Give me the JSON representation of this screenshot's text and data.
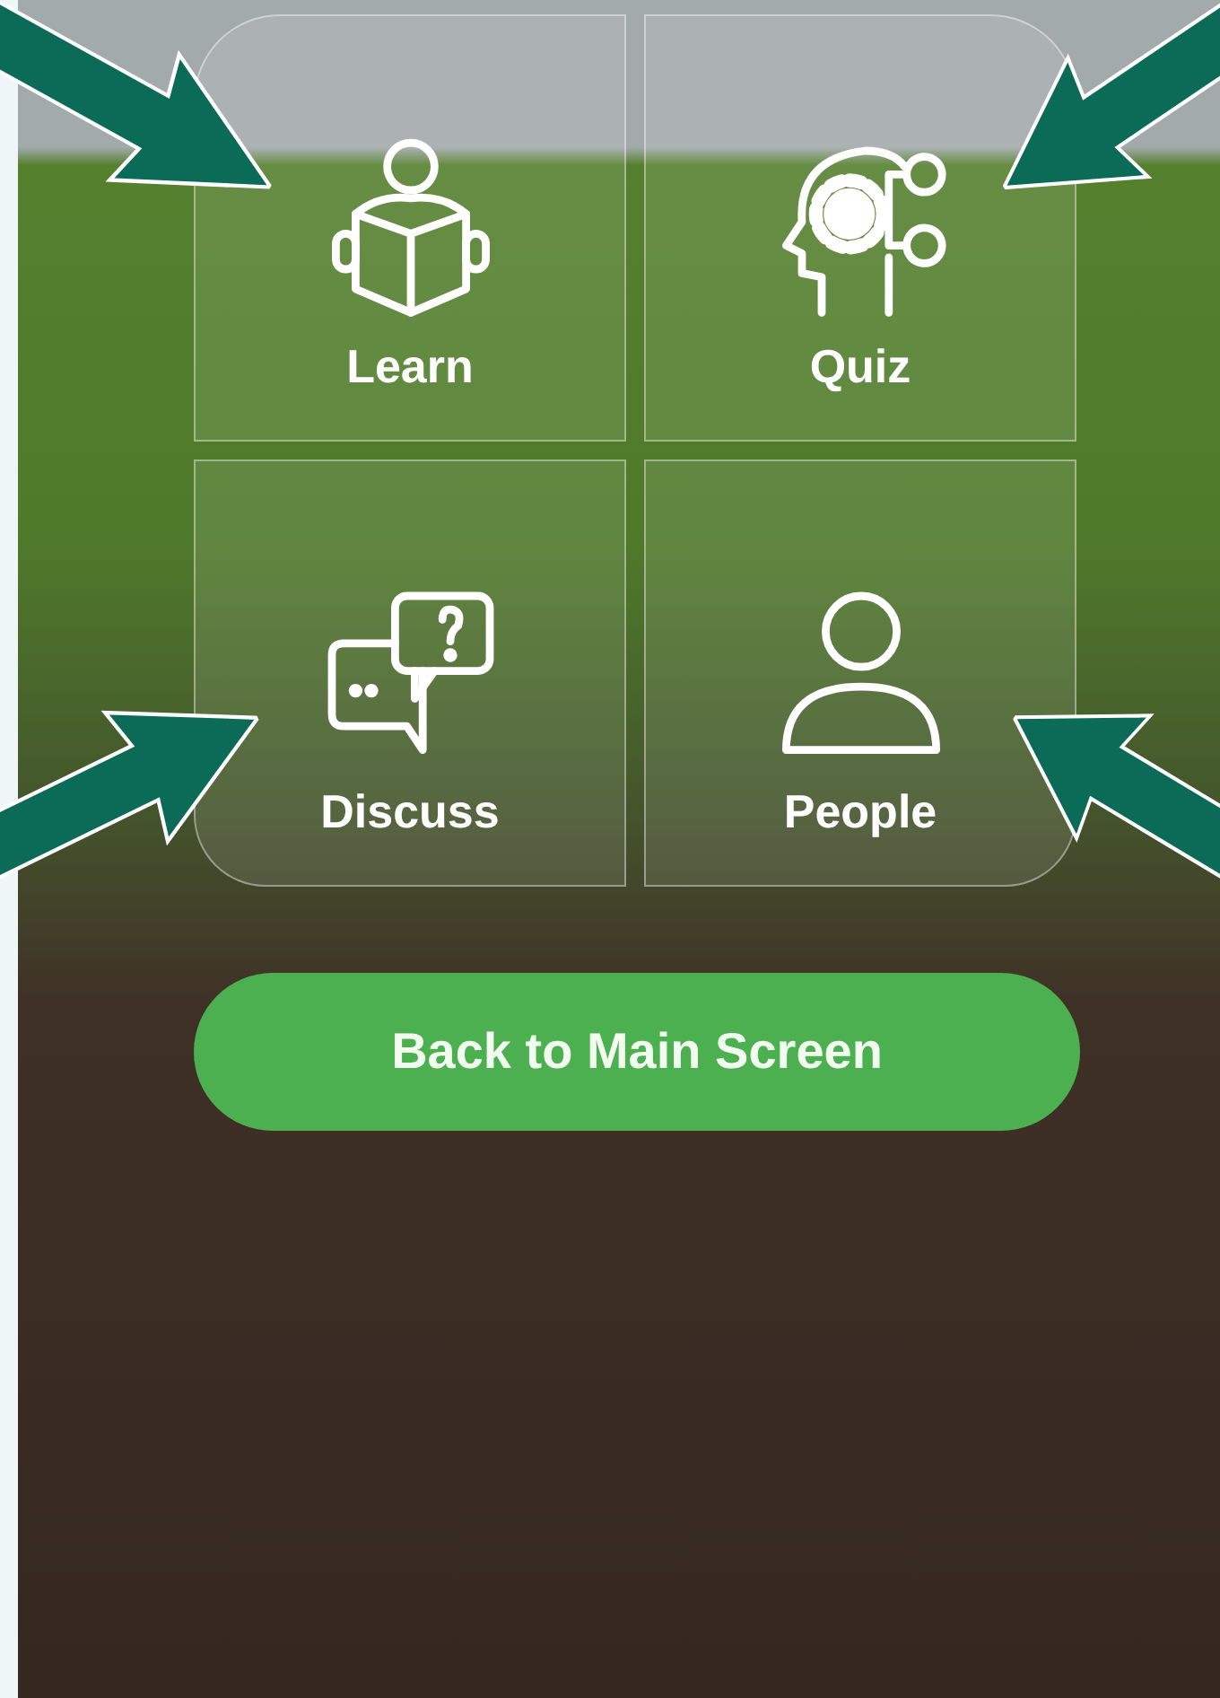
{
  "menu": {
    "tiles": [
      {
        "label": "Learn",
        "kind": "reader"
      },
      {
        "label": "Quiz",
        "kind": "mind"
      },
      {
        "label": "Discuss",
        "kind": "chat"
      },
      {
        "label": "People",
        "kind": "person"
      }
    ]
  },
  "back_button": {
    "label": "Back to Main Screen"
  }
}
